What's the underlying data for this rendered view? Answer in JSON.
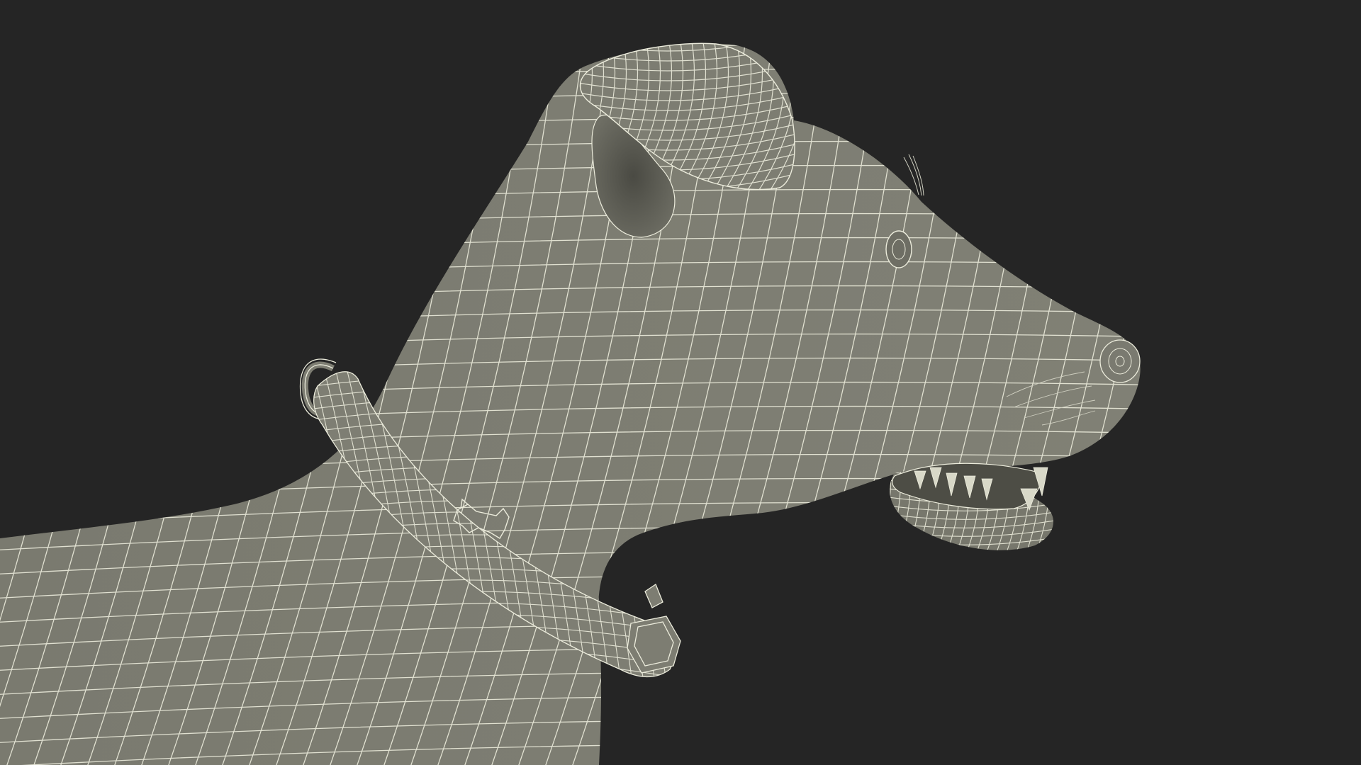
{
  "scene": {
    "subject": "dog-head-wireframe",
    "background_color": "#252525",
    "mesh_fill": "#7c7c71",
    "mesh_shade": "#66665c",
    "wire_color": "#ececdc",
    "cavity_color": "#4d4d45"
  }
}
